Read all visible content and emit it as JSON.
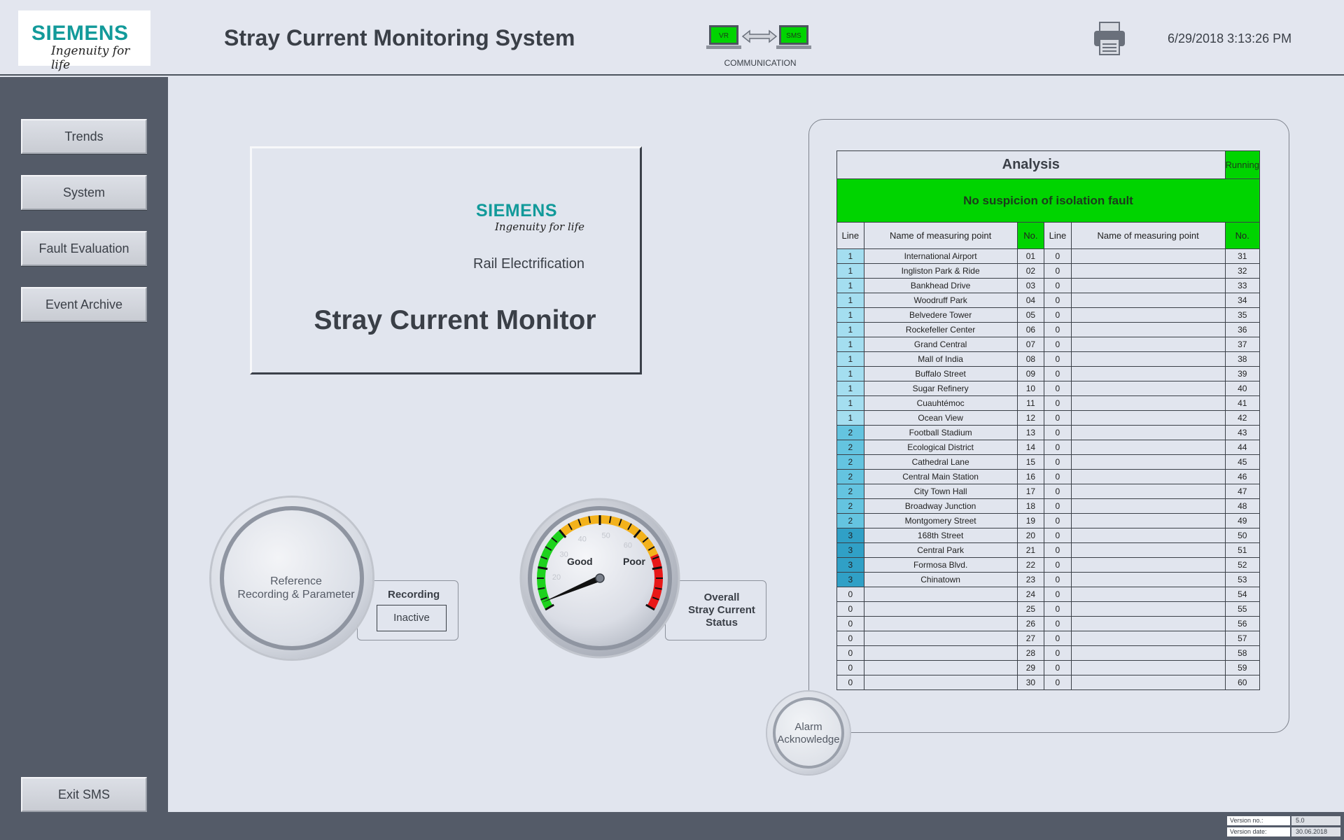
{
  "header": {
    "logo_word": "SIEMENS",
    "logo_tagline": "Ingenuity for life",
    "title": "Stray Current Monitoring System",
    "comm_left": "VR",
    "comm_right": "SMS",
    "comm_label": "COMMUNICATION",
    "datetime": "6/29/2018 3:13:26 PM"
  },
  "sidebar": {
    "items": [
      {
        "label": "Trends"
      },
      {
        "label": "System"
      },
      {
        "label": "Fault Evaluation"
      },
      {
        "label": "Event Archive"
      }
    ],
    "exit_label": "Exit SMS"
  },
  "title_card": {
    "logo_word": "SIEMENS",
    "logo_tagline": "Ingenuity for life",
    "subtitle": "Rail Electrification",
    "title": "Stray Current Monitor"
  },
  "reference": {
    "label_line1": "Reference",
    "label_line2": "Recording & Parameter",
    "recording_title": "Recording",
    "recording_value": "Inactive"
  },
  "gauge": {
    "good_label": "Good",
    "poor_label": "Poor",
    "tick_labels": [
      "20",
      "30",
      "40",
      "50",
      "60"
    ],
    "needle_level": 0.03,
    "status_line1": "Overall",
    "status_line2": "Stray Current",
    "status_line3": "Status"
  },
  "analysis": {
    "title": "Analysis",
    "state": "Running",
    "banner": "No suspicion of isolation fault",
    "columns": [
      "Line",
      "Name of measuring point",
      "No.",
      "Line",
      "Name of measuring point",
      "No."
    ],
    "rows": [
      [
        "1",
        "International Airport",
        "01",
        "0",
        "",
        "31"
      ],
      [
        "1",
        "Ingliston Park & Ride",
        "02",
        "0",
        "",
        "32"
      ],
      [
        "1",
        "Bankhead Drive",
        "03",
        "0",
        "",
        "33"
      ],
      [
        "1",
        "Woodruff Park",
        "04",
        "0",
        "",
        "34"
      ],
      [
        "1",
        "Belvedere Tower",
        "05",
        "0",
        "",
        "35"
      ],
      [
        "1",
        "Rockefeller Center",
        "06",
        "0",
        "",
        "36"
      ],
      [
        "1",
        "Grand Central",
        "07",
        "0",
        "",
        "37"
      ],
      [
        "1",
        "Mall of India",
        "08",
        "0",
        "",
        "38"
      ],
      [
        "1",
        "Buffalo Street",
        "09",
        "0",
        "",
        "39"
      ],
      [
        "1",
        "Sugar Refinery",
        "10",
        "0",
        "",
        "40"
      ],
      [
        "1",
        "Cuauhtémoc",
        "11",
        "0",
        "",
        "41"
      ],
      [
        "1",
        "Ocean View",
        "12",
        "0",
        "",
        "42"
      ],
      [
        "2",
        "Football Stadium",
        "13",
        "0",
        "",
        "43"
      ],
      [
        "2",
        "Ecological District",
        "14",
        "0",
        "",
        "44"
      ],
      [
        "2",
        "Cathedral Lane",
        "15",
        "0",
        "",
        "45"
      ],
      [
        "2",
        "Central Main Station",
        "16",
        "0",
        "",
        "46"
      ],
      [
        "2",
        "City Town Hall",
        "17",
        "0",
        "",
        "47"
      ],
      [
        "2",
        "Broadway Junction",
        "18",
        "0",
        "",
        "48"
      ],
      [
        "2",
        "Montgomery Street",
        "19",
        "0",
        "",
        "49"
      ],
      [
        "3",
        "168th Street",
        "20",
        "0",
        "",
        "50"
      ],
      [
        "3",
        "Central Park",
        "21",
        "0",
        "",
        "51"
      ],
      [
        "3",
        "Formosa Blvd.",
        "22",
        "0",
        "",
        "52"
      ],
      [
        "3",
        "Chinatown",
        "23",
        "0",
        "",
        "53"
      ],
      [
        "0",
        "",
        "24",
        "0",
        "",
        "54"
      ],
      [
        "0",
        "",
        "25",
        "0",
        "",
        "55"
      ],
      [
        "0",
        "",
        "26",
        "0",
        "",
        "56"
      ],
      [
        "0",
        "",
        "27",
        "0",
        "",
        "57"
      ],
      [
        "0",
        "",
        "28",
        "0",
        "",
        "58"
      ],
      [
        "0",
        "",
        "29",
        "0",
        "",
        "59"
      ],
      [
        "0",
        "",
        "30",
        "0",
        "",
        "60"
      ]
    ]
  },
  "alarm": {
    "line1": "Alarm",
    "line2": "Acknowledge"
  },
  "footer": {
    "version_label": "Version no.:",
    "version_value": "5.0",
    "date_label": "Version date:",
    "date_value": "30.06.2018"
  },
  "colors": {
    "status_green": "#00d400",
    "line1": "#a4def0",
    "line2": "#64c4e0",
    "line3": "#30a0c6",
    "brand_teal": "#129a9a"
  },
  "icons": {
    "printer": "printer-icon",
    "communication": "communication-icon"
  }
}
